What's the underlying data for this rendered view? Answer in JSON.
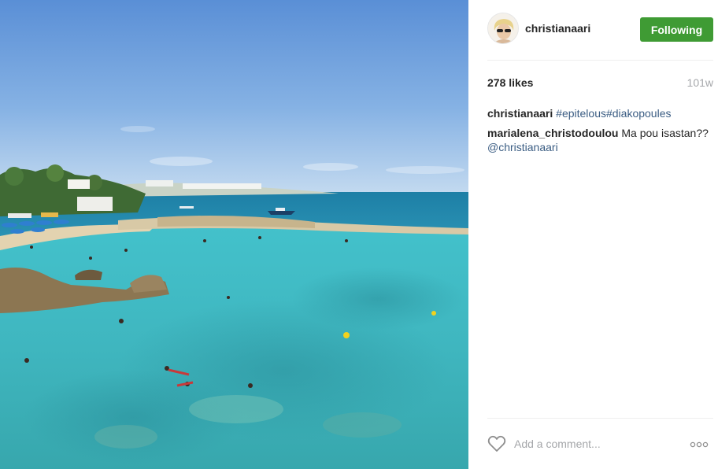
{
  "post": {
    "username": "christianaari",
    "follow_label": "Following",
    "likes": "278 likes",
    "age": "101w"
  },
  "comments": [
    {
      "user": "christianaari",
      "hashtags": "#epitelous#diakopoules"
    },
    {
      "user": "marialena_christodoulou",
      "text": "Ma pou isastan??",
      "mention": "@christianaari"
    }
  ],
  "comment_box": {
    "placeholder": "Add a comment..."
  },
  "icons": {
    "like": "heart-icon",
    "options": "more-options-icon"
  },
  "colors": {
    "follow_button": "#3f9b34",
    "link": "#3b5d83",
    "muted": "#a5a7aa"
  }
}
